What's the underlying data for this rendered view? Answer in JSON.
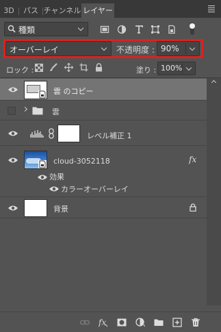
{
  "tabs": [
    {
      "label": "3D"
    },
    {
      "label": "パス"
    },
    {
      "label": "チャンネル"
    },
    {
      "label": "レイヤー",
      "active": true
    }
  ],
  "filter": {
    "kind_label": "種類"
  },
  "blend": {
    "mode": "オーバーレイ",
    "opacity_label": "不透明度 :",
    "opacity_value": "90%"
  },
  "lock": {
    "label": "ロック :",
    "fill_label": "塗り :",
    "fill_value": "100%"
  },
  "layers": [
    {
      "name": "雲 のコピー",
      "selected": true
    },
    {
      "name": "雲",
      "type": "group"
    },
    {
      "name": "レベル補正 1",
      "type": "adjustment"
    },
    {
      "name": "cloud-3052118",
      "fx_badge": "fx",
      "effects_label": "効果",
      "effect_name": "カラーオーバーレイ"
    },
    {
      "name": "背景",
      "locked": true
    }
  ],
  "colors": {
    "highlight": "#e0201e",
    "panel": "#535353",
    "selected": "#747474"
  }
}
